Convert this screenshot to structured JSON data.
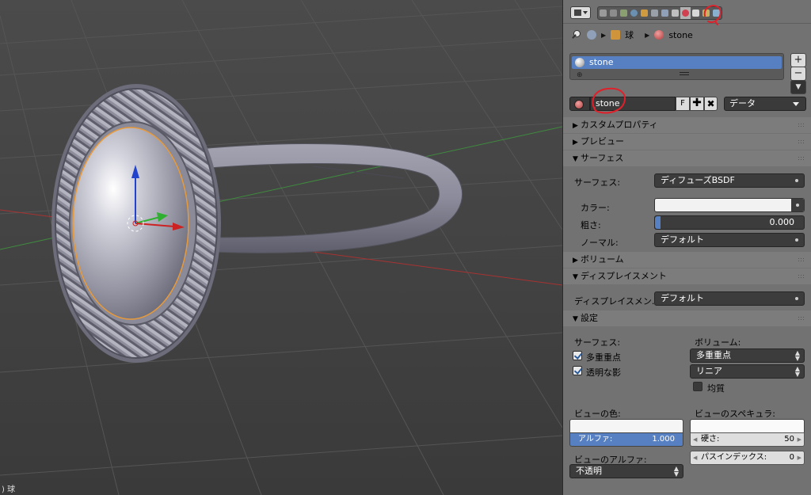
{
  "viewport": {
    "corner_text": ") 球"
  },
  "header": {
    "context_tabs": [
      {
        "icon": "render-icon",
        "color": "#9a9a9a"
      },
      {
        "icon": "render-layers-icon",
        "color": "#8c8c8c"
      },
      {
        "icon": "scene-icon",
        "color": "#8aa070"
      },
      {
        "icon": "world-icon",
        "color": "#6a8fb0"
      },
      {
        "icon": "object-icon",
        "color": "#d09a40"
      },
      {
        "icon": "constraints-icon",
        "color": "#9aa0a8"
      },
      {
        "icon": "modifiers-icon",
        "color": "#8fa0b8"
      },
      {
        "icon": "data-icon",
        "color": "#bfbfbf"
      },
      {
        "icon": "material-icon",
        "color": "#d04050",
        "active": true
      },
      {
        "icon": "texture-icon",
        "color": "#d8d8d8"
      },
      {
        "icon": "particles-icon",
        "color": "#c8b060"
      },
      {
        "icon": "physics-icon",
        "color": "#8ab0d0"
      }
    ]
  },
  "breadcrumb": {
    "object": "球",
    "material": "stone"
  },
  "material_slots": {
    "items": [
      "stone"
    ],
    "add_label": "+",
    "remove_label": "−",
    "special_label": "▼"
  },
  "material_datablock": {
    "name": "stone",
    "fake_user": "F",
    "add": "✚",
    "unlink": "✖",
    "link": "データ"
  },
  "sections": {
    "custom_props": "カスタムプロパティ",
    "preview": "プレビュー",
    "surface": "サーフェス",
    "volume": "ボリューム",
    "displacement": "ディスプレイスメント",
    "settings": "設定"
  },
  "surface": {
    "surface_label": "サーフェス:",
    "surface_value": "ディフューズBSDF",
    "color_label": "カラー:",
    "color_value": "#f2f2f2",
    "roughness_label": "粗さ:",
    "roughness_value": "0.000",
    "normal_label": "ノーマル:",
    "normal_value": "デフォルト"
  },
  "displacement": {
    "label": "ディスプレイスメン...",
    "value": "デフォルト"
  },
  "settings": {
    "surface_heading": "サーフェス:",
    "multiple_importance": "多重重点",
    "multiple_importance_checked": true,
    "transparent_shadow": "透明な影",
    "transparent_shadow_checked": true,
    "volume_heading": "ボリューム:",
    "volume_sampling": "多重重点",
    "volume_interpolation": "リニア",
    "homogeneous": "均質",
    "homogeneous_checked": false,
    "viewport_color_label": "ビューの色:",
    "viewport_color": "#f5f5f5",
    "alpha_label": "アルファ:",
    "alpha_value": "1.000",
    "viewport_specular_label": "ビューのスペキュラ:",
    "hardness_label": "硬さ:",
    "hardness_value": "50",
    "pass_index_label": "パスインデックス:",
    "pass_index_value": "0",
    "viewport_alpha_label": "ビューのアルファ:",
    "viewport_alpha_value": "不透明"
  }
}
